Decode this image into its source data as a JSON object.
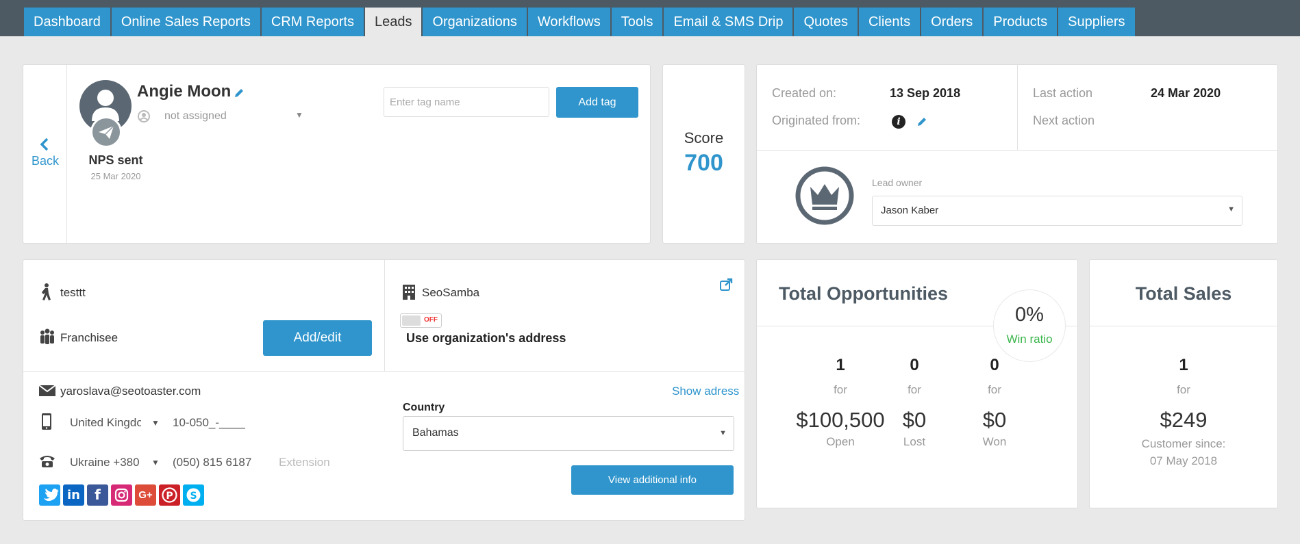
{
  "nav": {
    "tabs": [
      {
        "label": "Dashboard",
        "active": false
      },
      {
        "label": "Online Sales Reports",
        "active": false
      },
      {
        "label": "CRM Reports",
        "active": false
      },
      {
        "label": "Leads",
        "active": true
      },
      {
        "label": "Organizations",
        "active": false
      },
      {
        "label": "Workflows",
        "active": false
      },
      {
        "label": "Tools",
        "active": false
      },
      {
        "label": "Email & SMS Drip",
        "active": false
      },
      {
        "label": "Quotes",
        "active": false
      },
      {
        "label": "Clients",
        "active": false
      },
      {
        "label": "Orders",
        "active": false
      },
      {
        "label": "Products",
        "active": false
      },
      {
        "label": "Suppliers",
        "active": false
      }
    ]
  },
  "profile": {
    "back_label": "Back",
    "name": "Angie Moon",
    "assigned": "not assigned",
    "status": "NPS sent",
    "status_date": "25 Mar 2020",
    "tag_placeholder": "Enter tag name",
    "add_tag_label": "Add tag"
  },
  "score": {
    "label": "Score",
    "value": "700"
  },
  "info": {
    "created_label": "Created on:",
    "created_value": "13 Sep 2018",
    "originated_label": "Originated from:",
    "last_action_label": "Last action",
    "last_action_value": "24 Mar 2020",
    "next_action_label": "Next action",
    "owner_label": "Lead owner",
    "owner_value": "Jason Kaber"
  },
  "contact": {
    "position": "testtt",
    "role": "Franchisee",
    "add_edit_label": "Add/edit",
    "organization": "SeoSamba",
    "toggle_state": "OFF",
    "use_org_address": "Use organization's address",
    "email": "yaroslava@seotoaster.com",
    "show_address": "Show adress",
    "mobile_country": "United Kingdo",
    "mobile_number": "10-050_-____",
    "phone_country": "Ukraine +380",
    "phone_number": "(050) 815 6187",
    "extension_placeholder": "Extension",
    "country_label": "Country",
    "country_value": "Bahamas",
    "view_info_label": "View additional info",
    "socials": [
      "twitter-icon",
      "linkedin-icon",
      "facebook-icon",
      "instagram-icon",
      "google-plus-icon",
      "pinterest-icon",
      "skype-icon"
    ]
  },
  "opportunities": {
    "title": "Total Opportunities",
    "win_pct": "0%",
    "win_label": "Win ratio",
    "columns": [
      {
        "count": "1",
        "for": "for",
        "amount": "$100,500",
        "label": "Open"
      },
      {
        "count": "0",
        "for": "for",
        "amount": "$0",
        "label": "Lost"
      },
      {
        "count": "0",
        "for": "for",
        "amount": "$0",
        "label": "Won"
      }
    ]
  },
  "sales": {
    "title": "Total Sales",
    "count": "1",
    "for": "for",
    "amount": "$249",
    "since_label": "Customer since:",
    "since_date": "07 May 2018"
  },
  "colors": {
    "accent": "#2f95cc",
    "topbar": "#4d5a64",
    "win_green": "#39b54a",
    "off_red": "#ee3333"
  }
}
